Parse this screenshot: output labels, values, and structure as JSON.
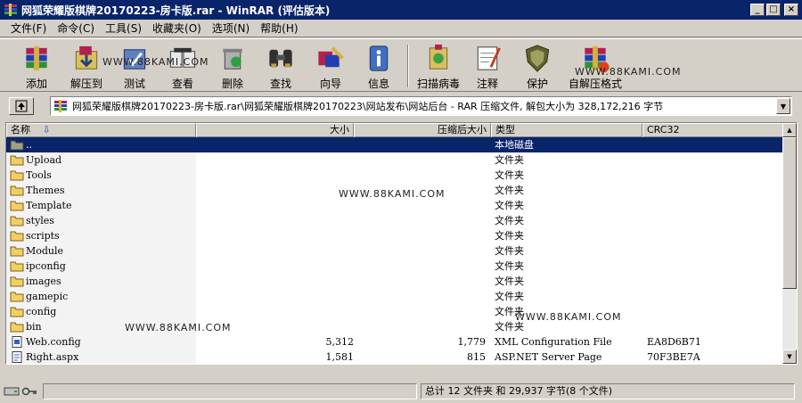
{
  "window": {
    "title": "网狐荣耀版棋牌20170223-房卡版.rar - WinRAR (评估版本)"
  },
  "menu": [
    "文件(F)",
    "命令(C)",
    "工具(S)",
    "收藏夹(O)",
    "选项(N)",
    "帮助(H)"
  ],
  "toolbar": [
    {
      "label": "添加",
      "icon": "add-archive-icon"
    },
    {
      "label": "解压到",
      "icon": "extract-to-icon"
    },
    {
      "label": "测试",
      "icon": "test-icon"
    },
    {
      "label": "查看",
      "icon": "view-icon"
    },
    {
      "label": "删除",
      "icon": "delete-icon"
    },
    {
      "label": "查找",
      "icon": "find-icon"
    },
    {
      "label": "向导",
      "icon": "wizard-icon"
    },
    {
      "label": "信息",
      "icon": "info-icon"
    },
    {
      "label": "扫描病毒",
      "icon": "virus-scan-icon"
    },
    {
      "label": "注释",
      "icon": "comment-icon"
    },
    {
      "label": "保护",
      "icon": "protect-icon"
    },
    {
      "label": "自解压格式",
      "icon": "sfx-icon"
    }
  ],
  "watermark": "WWW.88KAMI.COM",
  "address": {
    "path": "网狐荣耀版棋牌20170223-房卡版.rar\\网狐荣耀版棋牌20170223\\网站发布\\网站后台 - RAR 压缩文件, 解包大小为 328,172,216 字节"
  },
  "columns": {
    "name": "名称",
    "size": "大小",
    "packed": "压缩后大小",
    "type": "类型",
    "crc": "CRC32"
  },
  "rows": [
    {
      "name": "..",
      "size": "",
      "packed": "",
      "type": "本地磁盘",
      "crc": "",
      "icon": "parent-folder-icon"
    },
    {
      "name": "Upload",
      "size": "",
      "packed": "",
      "type": "文件夹",
      "crc": "",
      "icon": "folder-icon"
    },
    {
      "name": "Tools",
      "size": "",
      "packed": "",
      "type": "文件夹",
      "crc": "",
      "icon": "folder-icon"
    },
    {
      "name": "Themes",
      "size": "",
      "packed": "",
      "type": "文件夹",
      "crc": "",
      "icon": "folder-icon"
    },
    {
      "name": "Template",
      "size": "",
      "packed": "",
      "type": "文件夹",
      "crc": "",
      "icon": "folder-icon"
    },
    {
      "name": "styles",
      "size": "",
      "packed": "",
      "type": "文件夹",
      "crc": "",
      "icon": "folder-icon"
    },
    {
      "name": "scripts",
      "size": "",
      "packed": "",
      "type": "文件夹",
      "crc": "",
      "icon": "folder-icon"
    },
    {
      "name": "Module",
      "size": "",
      "packed": "",
      "type": "文件夹",
      "crc": "",
      "icon": "folder-icon"
    },
    {
      "name": "ipconfig",
      "size": "",
      "packed": "",
      "type": "文件夹",
      "crc": "",
      "icon": "folder-icon"
    },
    {
      "name": "images",
      "size": "",
      "packed": "",
      "type": "文件夹",
      "crc": "",
      "icon": "folder-icon"
    },
    {
      "name": "gamepic",
      "size": "",
      "packed": "",
      "type": "文件夹",
      "crc": "",
      "icon": "folder-icon"
    },
    {
      "name": "config",
      "size": "",
      "packed": "",
      "type": "文件夹",
      "crc": "",
      "icon": "folder-icon"
    },
    {
      "name": "bin",
      "size": "",
      "packed": "",
      "type": "文件夹",
      "crc": "",
      "icon": "folder-icon"
    },
    {
      "name": "Web.config",
      "size": "5,312",
      "packed": "1,779",
      "type": "XML Configuration File",
      "crc": "EA8D6B71",
      "icon": "xml-file-icon"
    },
    {
      "name": "Right.aspx",
      "size": "1,581",
      "packed": "815",
      "type": "ASP.NET Server Page",
      "crc": "70F3BE7A",
      "icon": "aspx-file-icon"
    }
  ],
  "status": {
    "right": "总计 12 文件夹 和 29,937 字节(8 个文件)"
  },
  "colors": {
    "title_bg": "#0a246a",
    "window_bg": "#d4d0c8",
    "selection": "#0a246a"
  }
}
